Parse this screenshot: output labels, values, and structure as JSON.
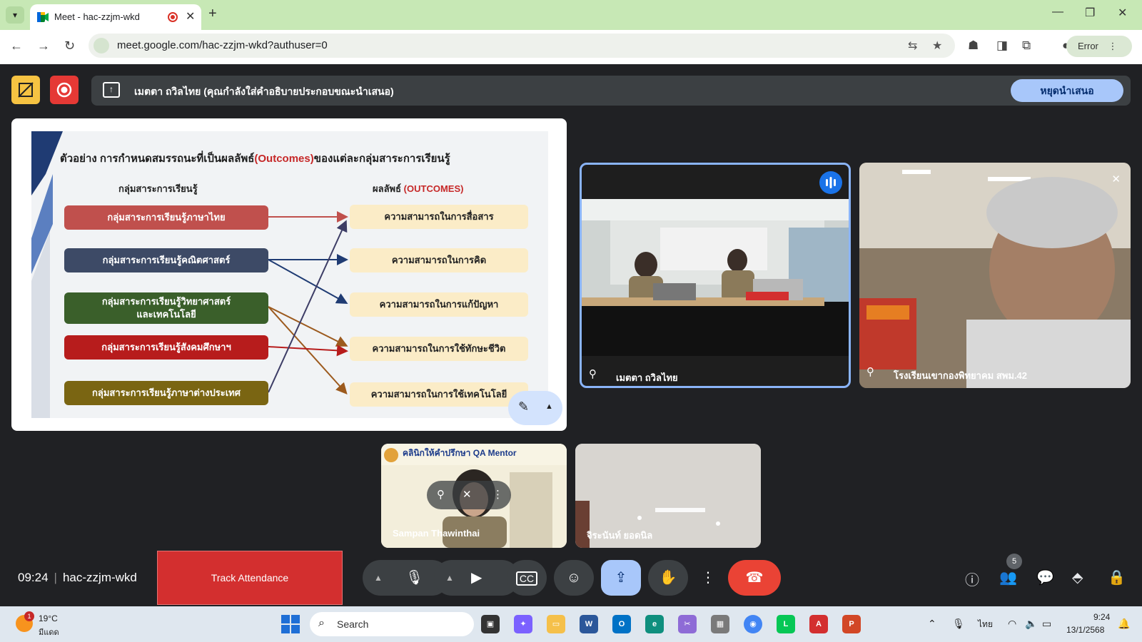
{
  "browser": {
    "tab_title": "Meet - hac-zzjm-wkd",
    "url": "meet.google.com/hac-zzjm-wkd?authuser=0",
    "profile_button": "Error"
  },
  "banner": {
    "presenting_text": "เมตตา ถวิลไทย (คุณกำลังใส่คำอธิบายประกอบขณะนำเสนอ)",
    "stop_label": "หยุดนำเสนอ"
  },
  "slide": {
    "title_before": "ตัวอย่าง การกำหนดสมรรถนะที่เป็นผลลัพธ์",
    "title_highlight": "(Outcomes)",
    "title_after": "ของแต่ละกลุ่มสาระการเรียนรู้",
    "left_header": "กลุ่มสาระการเรียนรู้",
    "right_header_before": "ผลลัพธ์ ",
    "right_header_highlight": "(OUTCOMES)",
    "subjects": [
      {
        "line1": "กลุ่มสาระการเรียนรู้ภาษาไทย",
        "line2": "",
        "color": "#c0504d"
      },
      {
        "line1": "กลุ่มสาระการเรียนรู้คณิตศาสตร์",
        "line2": "",
        "color": "#3d4a66"
      },
      {
        "line1": "กลุ่มสาระการเรียนรู้วิทยาศาสตร์",
        "line2": "และเทคโนโลยี",
        "color": "#3a5f2a"
      },
      {
        "line1": "กลุ่มสาระการเรียนรู้สังคมศึกษาฯ",
        "line2": "",
        "color": "#b71c1c"
      },
      {
        "line1": "กลุ่มสาระการเรียนรู้ภาษาต่างประเทศ",
        "line2": "",
        "color": "#7a6512"
      }
    ],
    "outcomes": [
      "ความสามารถในการสื่อสาร",
      "ความสามารถในการคิด",
      "ความสามารถในการแก้ปัญหา",
      "ความสามารถในการใช้ทักษะชีวิต",
      "ความสามารถในการใช้เทคโนโลยี"
    ]
  },
  "participants": {
    "presenter": "เมตตา ถวิลไทย",
    "school": "โรงเรียนเขากองพิทยาคม สพม.42",
    "mentor": "Sampan Thawinthai",
    "mentor_overlay": "คลินิกให้คำปรึกษา QA Mentor",
    "fourth": "จิระนันท์ ยอดนิล"
  },
  "meeting": {
    "time": "09:24",
    "code": "hac-zzjm-wkd",
    "track_label": "Track Attendance",
    "people_count": "5"
  },
  "taskbar": {
    "temperature": "19°C",
    "weather": "มีแดด",
    "weather_badge": "1",
    "search_label": "Search",
    "lang": "ไทย",
    "clock_time": "9:24",
    "clock_date": "13/1/2568"
  },
  "icons": {
    "mic": "microphone-icon",
    "camera": "camera-icon",
    "captions": "captions-icon",
    "emoji": "emoji-icon",
    "present": "present-screen-icon",
    "hand": "raise-hand-icon",
    "more": "more-vert-icon",
    "hangup": "hang-up-icon"
  },
  "colors": {
    "accent_blue": "#a8c7fa",
    "hangup_red": "#ea4335",
    "track_red": "#d32f2f",
    "speaking_border": "#8ab4f8"
  }
}
